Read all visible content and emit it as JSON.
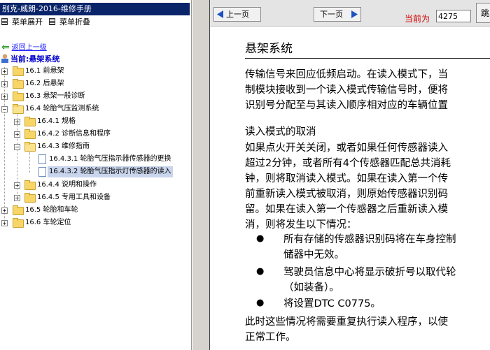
{
  "left_panel": {
    "manual_title": "别克-威朗-2016-维修手册",
    "expand_menu_label": "菜单展开",
    "collapse_menu_label": "菜单折叠",
    "back_link": "返回上一级",
    "current_node": "当前:悬架系统",
    "tree": [
      {
        "label": "16.1 前悬架"
      },
      {
        "label": "16.2 后悬架"
      },
      {
        "label": "16.3 悬架一般诊断"
      },
      {
        "label": "16.4 轮胎气压监测系统"
      },
      {
        "label": "16.4.1 规格"
      },
      {
        "label": "16.4.2 诊断信息和程序"
      },
      {
        "label": "16.4.3 维修指南"
      },
      {
        "label": "16.4.3.1 轮胎气压指示器传感器的更换"
      },
      {
        "label": "16.4.3.2 轮胎气压指示灯传感器的读入"
      },
      {
        "label": "16.4.4 说明和操作"
      },
      {
        "label": "16.4.5 专用工具和设备"
      },
      {
        "label": "16.5 轮胎和车轮"
      },
      {
        "label": "16.6 车轮定位"
      }
    ]
  },
  "toolbar": {
    "prev_label": "上一页",
    "next_label": "下一页",
    "current_page_label": "当前为",
    "page_number": "4275",
    "jump_label": "跳"
  },
  "content": {
    "title": "悬架系统",
    "intro_lines": [
      "传输信号来回应低频启动。在读入模式下，当",
      "制模块接收到一个读入模式传输信号时，便将",
      "识别号分配至与其读入顺序相对应的车辆位置"
    ],
    "section_heading": "读入模式的取消",
    "section_lines": [
      "如果点火开关关闭，或者如果任何传感器读入",
      "超过2分钟，或者所有4个传感器匹配总共消耗",
      "钟，则将取消读入模式。如果在读入第一个传",
      "前重新读入模式被取消，则原始传感器识别码",
      "留。如果在读入第一个传感器之后重新读入模",
      "消，则将发生以下情况："
    ],
    "bullets": [
      {
        "lines": [
          "所有存储的传感器识别码将在车身控制",
          "储器中无效。"
        ]
      },
      {
        "lines": [
          "驾驶员信息中心将显示破折号以取代轮",
          "（如装备）。"
        ]
      },
      {
        "lines": [
          "将设置DTC C0775。"
        ]
      }
    ],
    "closing_lines": [
      "此时这些情况将需要重复执行读入程序，以使",
      "正常工作。"
    ]
  },
  "colors": {
    "title_bar": "#0a246a",
    "link": "#1a1aff",
    "current_node": "#0000cc",
    "page_label": "#d00000",
    "selection": "#c9d5ec"
  }
}
